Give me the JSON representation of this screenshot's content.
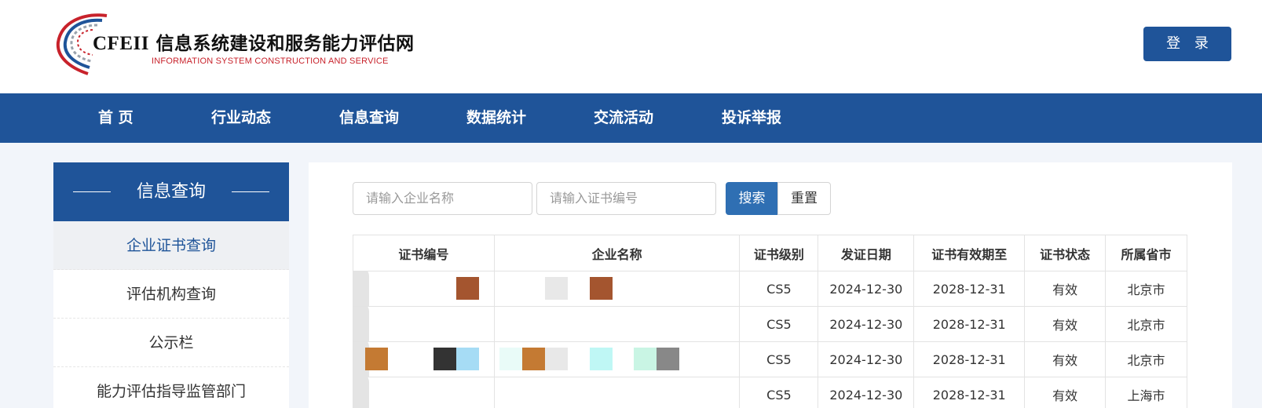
{
  "header": {
    "logo_latin": "CFEII",
    "logo_title": "信息系统建设和服务能力评估网",
    "logo_subtitle": "INFORMATION SYSTEM CONSTRUCTION AND SERVICE",
    "login_label": "登 录"
  },
  "nav": {
    "items": [
      "首 页",
      "行业动态",
      "信息查询",
      "数据统计",
      "交流活动",
      "投诉举报"
    ]
  },
  "sidebar": {
    "title": "信息查询",
    "items": [
      "企业证书查询",
      "评估机构查询",
      "公示栏",
      "能力评估指导监管部门"
    ],
    "active_index": 0
  },
  "search": {
    "company_placeholder": "请输入企业名称",
    "cert_placeholder": "请输入证书编号",
    "search_label": "搜索",
    "reset_label": "重置"
  },
  "table": {
    "headers": [
      "证书编号",
      "企业名称",
      "证书级别",
      "发证日期",
      "证书有效期至",
      "证书状态",
      "所属省市"
    ],
    "rows": [
      {
        "level": "CS5",
        "issue_date": "2024-12-30",
        "valid_until": "2028-12-31",
        "status": "有效",
        "province": "北京市"
      },
      {
        "level": "CS5",
        "issue_date": "2024-12-30",
        "valid_until": "2028-12-31",
        "status": "有效",
        "province": "北京市"
      },
      {
        "level": "CS5",
        "issue_date": "2024-12-30",
        "valid_until": "2028-12-31",
        "status": "有效",
        "province": "北京市"
      },
      {
        "level": "CS5",
        "issue_date": "2024-12-30",
        "valid_until": "2028-12-31",
        "status": "有效",
        "province": "上海市"
      }
    ]
  },
  "colors": {
    "brand_blue": "#1f5499",
    "button_blue": "#2f6fb3",
    "logo_red": "#c8222b",
    "page_bg": "#f2f5fa"
  }
}
